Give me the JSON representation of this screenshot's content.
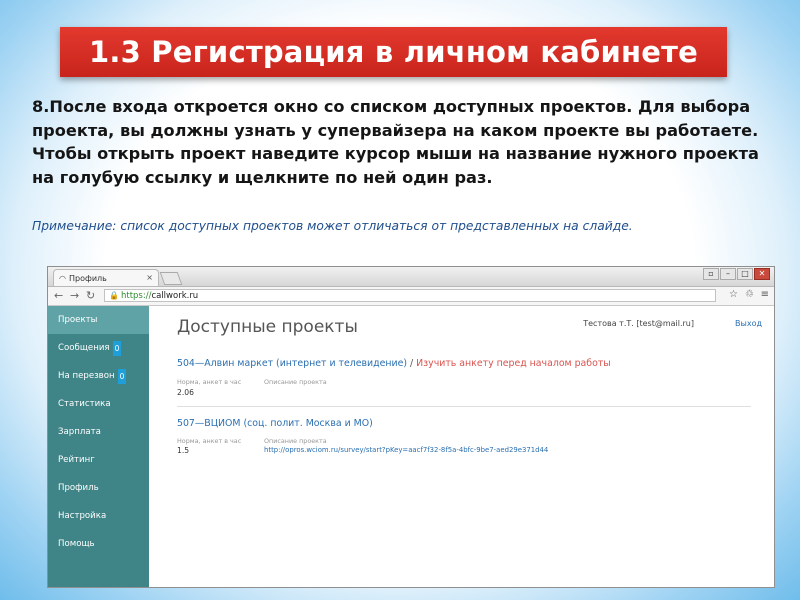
{
  "slide": {
    "title": "1.3 Регистрация в личном кабинете",
    "paragraph1": "8.После входа откроется  окно со списком доступных проектов. Для выбора проекта, вы должны узнать у супервайзера на каком проекте вы работаете.",
    "paragraph2": "Чтобы открыть проект наведите курсор мыши на название нужного проекта на голубую ссылку и щелкните по ней один раз.",
    "note": "Примечание: список доступных проектов может отличаться от представленных на слайде."
  },
  "browser": {
    "tab_title": "Профиль",
    "tab_close": "×",
    "url_scheme": "https://",
    "url_rest": "callwork.ru"
  },
  "sidebar": {
    "items": [
      {
        "label": "Проекты"
      },
      {
        "label": "Сообщения",
        "badge": "0"
      },
      {
        "label": "На перезвон",
        "badge": "0"
      },
      {
        "label": "Статистика"
      },
      {
        "label": "Зарплата"
      },
      {
        "label": "Рейтинг"
      },
      {
        "label": "Профиль"
      },
      {
        "label": "Настройка"
      },
      {
        "label": "Помощь"
      }
    ]
  },
  "main": {
    "title": "Доступные проекты",
    "user": "Тестова т.Т. [test@mail.ru]",
    "logout": "Выход",
    "projects": [
      {
        "name": "504—Алвин маркет (интернет и телевидение)",
        "sep": " / ",
        "survey_link": "Изучить анкету перед началом работы",
        "norm_label": "Норма, анкет в час",
        "norm_value": "2.06",
        "desc_label": "Описание проекта"
      },
      {
        "name": "507—ВЦИОМ (соц. полит. Москва и МО)",
        "norm_label": "Норма, анкет в час",
        "norm_value": "1.5",
        "desc_label": "Описание проекта",
        "desc_link": "http://opros.wciom.ru/survey/start?pKey=aacf7f32-8f5a-4bfc-9be7-aed29e371d44"
      }
    ]
  },
  "colors": {
    "title_red": "#d8312a",
    "sidebar_teal": "#3f8487",
    "sidebar_active": "#5fa3a7",
    "badge_blue": "#1f9fd9",
    "link_blue": "#2a6fb0",
    "survey_red": "#d9534f"
  }
}
